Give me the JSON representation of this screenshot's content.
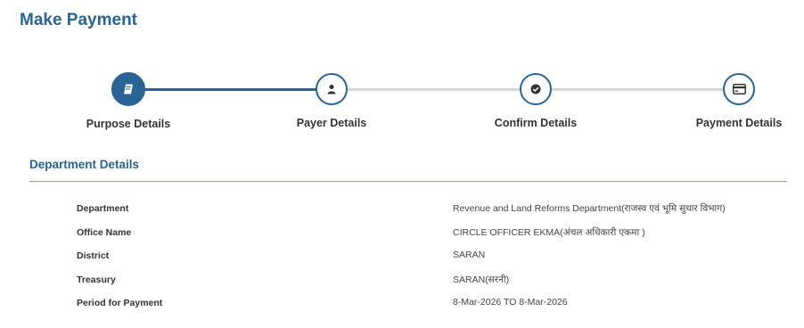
{
  "page": {
    "title": "Make Payment"
  },
  "stepper": {
    "steps": [
      {
        "label": "Purpose Details",
        "icon": "document-icon",
        "state": "active"
      },
      {
        "label": "Payer Details",
        "icon": "user-icon",
        "state": "pending"
      },
      {
        "label": "Confirm Details",
        "icon": "check-circle-icon",
        "state": "pending"
      },
      {
        "label": "Payment Details",
        "icon": "credit-card-icon",
        "state": "pending"
      }
    ],
    "colors": {
      "active": "#2a6496",
      "inactive_track": "#d4d7db"
    }
  },
  "section": {
    "title": "Department Details",
    "rows": [
      {
        "key": "Department",
        "value": "Revenue and Land Reforms Department(राजस्व एवं भूमि सुधार विभाग)"
      },
      {
        "key": "Office Name",
        "value": "CIRCLE OFFICER EKMA(अंचल अधिकारी एकमा )"
      },
      {
        "key": "District",
        "value": "SARAN"
      },
      {
        "key": "Treasury",
        "value": "SARAN(सरनी)"
      },
      {
        "key": "Period for Payment",
        "value": "8-Mar-2026 TO 8-Mar-2026"
      }
    ]
  }
}
